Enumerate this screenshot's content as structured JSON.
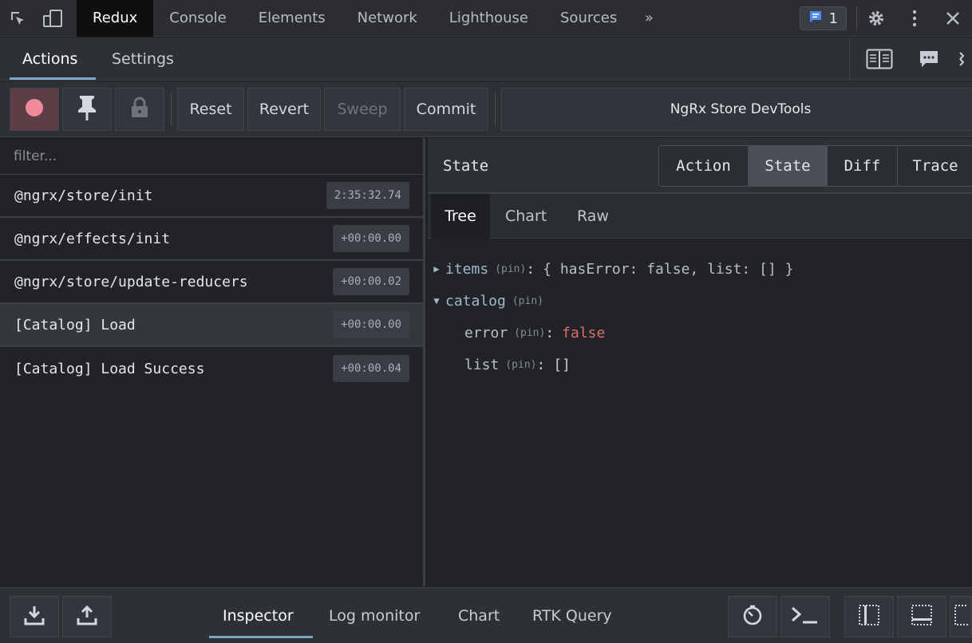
{
  "devtools": {
    "tabs": [
      "Redux",
      "Console",
      "Elements",
      "Network",
      "Lighthouse",
      "Sources"
    ],
    "more": "»",
    "issues_count": "1"
  },
  "panel": {
    "tabs": [
      "Actions",
      "Settings"
    ]
  },
  "toolbar": {
    "reset": "Reset",
    "revert": "Revert",
    "sweep": "Sweep",
    "commit": "Commit",
    "instance_title": "NgRx Store DevTools"
  },
  "actions": {
    "filter_placeholder": "filter...",
    "items": [
      {
        "name": "@ngrx/store/init",
        "time": "2:35:32.74"
      },
      {
        "name": "@ngrx/effects/init",
        "time": "+00:00.00"
      },
      {
        "name": "@ngrx/store/update-reducers",
        "time": "+00:00.02"
      },
      {
        "name": "[Catalog] Load",
        "time": "+00:00.00"
      },
      {
        "name": "[Catalog] Load Success",
        "time": "+00:00.04"
      }
    ]
  },
  "inspector": {
    "title": "State",
    "views": [
      "Action",
      "State",
      "Diff",
      "Trace"
    ],
    "sub_tabs": [
      "Tree",
      "Chart",
      "Raw"
    ],
    "tree": {
      "items_key": "items",
      "items_summary": "{ hasError: false, list: [] }",
      "catalog_key": "catalog",
      "error_key": "error",
      "error_value": "false",
      "list_key": "list",
      "list_value": "[]",
      "pin_label": "(pin)",
      "colon": ":"
    }
  },
  "monitors": [
    "Inspector",
    "Log monitor",
    "Chart",
    "RTK Query"
  ],
  "colors": {
    "accent": "#7aa7c4",
    "record": "#f08a9a",
    "false_value": "#e06c6c"
  }
}
